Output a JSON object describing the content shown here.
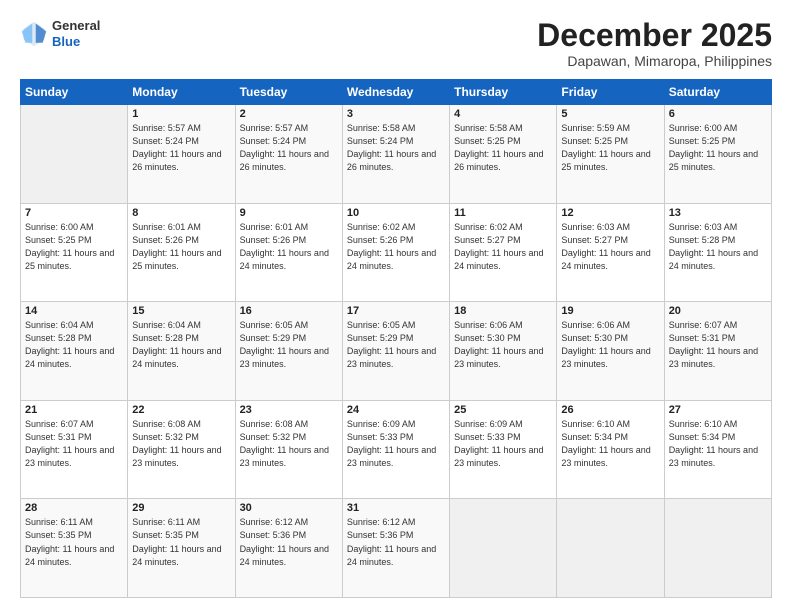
{
  "header": {
    "logo_general": "General",
    "logo_blue": "Blue",
    "title": "December 2025",
    "subtitle": "Dapawan, Mimaropa, Philippines"
  },
  "weekdays": [
    "Sunday",
    "Monday",
    "Tuesday",
    "Wednesday",
    "Thursday",
    "Friday",
    "Saturday"
  ],
  "weeks": [
    [
      {
        "day": "",
        "sunrise": "",
        "sunset": "",
        "daylight": ""
      },
      {
        "day": "1",
        "sunrise": "Sunrise: 5:57 AM",
        "sunset": "Sunset: 5:24 PM",
        "daylight": "Daylight: 11 hours and 26 minutes."
      },
      {
        "day": "2",
        "sunrise": "Sunrise: 5:57 AM",
        "sunset": "Sunset: 5:24 PM",
        "daylight": "Daylight: 11 hours and 26 minutes."
      },
      {
        "day": "3",
        "sunrise": "Sunrise: 5:58 AM",
        "sunset": "Sunset: 5:24 PM",
        "daylight": "Daylight: 11 hours and 26 minutes."
      },
      {
        "day": "4",
        "sunrise": "Sunrise: 5:58 AM",
        "sunset": "Sunset: 5:25 PM",
        "daylight": "Daylight: 11 hours and 26 minutes."
      },
      {
        "day": "5",
        "sunrise": "Sunrise: 5:59 AM",
        "sunset": "Sunset: 5:25 PM",
        "daylight": "Daylight: 11 hours and 25 minutes."
      },
      {
        "day": "6",
        "sunrise": "Sunrise: 6:00 AM",
        "sunset": "Sunset: 5:25 PM",
        "daylight": "Daylight: 11 hours and 25 minutes."
      }
    ],
    [
      {
        "day": "7",
        "sunrise": "Sunrise: 6:00 AM",
        "sunset": "Sunset: 5:25 PM",
        "daylight": "Daylight: 11 hours and 25 minutes."
      },
      {
        "day": "8",
        "sunrise": "Sunrise: 6:01 AM",
        "sunset": "Sunset: 5:26 PM",
        "daylight": "Daylight: 11 hours and 25 minutes."
      },
      {
        "day": "9",
        "sunrise": "Sunrise: 6:01 AM",
        "sunset": "Sunset: 5:26 PM",
        "daylight": "Daylight: 11 hours and 24 minutes."
      },
      {
        "day": "10",
        "sunrise": "Sunrise: 6:02 AM",
        "sunset": "Sunset: 5:26 PM",
        "daylight": "Daylight: 11 hours and 24 minutes."
      },
      {
        "day": "11",
        "sunrise": "Sunrise: 6:02 AM",
        "sunset": "Sunset: 5:27 PM",
        "daylight": "Daylight: 11 hours and 24 minutes."
      },
      {
        "day": "12",
        "sunrise": "Sunrise: 6:03 AM",
        "sunset": "Sunset: 5:27 PM",
        "daylight": "Daylight: 11 hours and 24 minutes."
      },
      {
        "day": "13",
        "sunrise": "Sunrise: 6:03 AM",
        "sunset": "Sunset: 5:28 PM",
        "daylight": "Daylight: 11 hours and 24 minutes."
      }
    ],
    [
      {
        "day": "14",
        "sunrise": "Sunrise: 6:04 AM",
        "sunset": "Sunset: 5:28 PM",
        "daylight": "Daylight: 11 hours and 24 minutes."
      },
      {
        "day": "15",
        "sunrise": "Sunrise: 6:04 AM",
        "sunset": "Sunset: 5:28 PM",
        "daylight": "Daylight: 11 hours and 24 minutes."
      },
      {
        "day": "16",
        "sunrise": "Sunrise: 6:05 AM",
        "sunset": "Sunset: 5:29 PM",
        "daylight": "Daylight: 11 hours and 23 minutes."
      },
      {
        "day": "17",
        "sunrise": "Sunrise: 6:05 AM",
        "sunset": "Sunset: 5:29 PM",
        "daylight": "Daylight: 11 hours and 23 minutes."
      },
      {
        "day": "18",
        "sunrise": "Sunrise: 6:06 AM",
        "sunset": "Sunset: 5:30 PM",
        "daylight": "Daylight: 11 hours and 23 minutes."
      },
      {
        "day": "19",
        "sunrise": "Sunrise: 6:06 AM",
        "sunset": "Sunset: 5:30 PM",
        "daylight": "Daylight: 11 hours and 23 minutes."
      },
      {
        "day": "20",
        "sunrise": "Sunrise: 6:07 AM",
        "sunset": "Sunset: 5:31 PM",
        "daylight": "Daylight: 11 hours and 23 minutes."
      }
    ],
    [
      {
        "day": "21",
        "sunrise": "Sunrise: 6:07 AM",
        "sunset": "Sunset: 5:31 PM",
        "daylight": "Daylight: 11 hours and 23 minutes."
      },
      {
        "day": "22",
        "sunrise": "Sunrise: 6:08 AM",
        "sunset": "Sunset: 5:32 PM",
        "daylight": "Daylight: 11 hours and 23 minutes."
      },
      {
        "day": "23",
        "sunrise": "Sunrise: 6:08 AM",
        "sunset": "Sunset: 5:32 PM",
        "daylight": "Daylight: 11 hours and 23 minutes."
      },
      {
        "day": "24",
        "sunrise": "Sunrise: 6:09 AM",
        "sunset": "Sunset: 5:33 PM",
        "daylight": "Daylight: 11 hours and 23 minutes."
      },
      {
        "day": "25",
        "sunrise": "Sunrise: 6:09 AM",
        "sunset": "Sunset: 5:33 PM",
        "daylight": "Daylight: 11 hours and 23 minutes."
      },
      {
        "day": "26",
        "sunrise": "Sunrise: 6:10 AM",
        "sunset": "Sunset: 5:34 PM",
        "daylight": "Daylight: 11 hours and 23 minutes."
      },
      {
        "day": "27",
        "sunrise": "Sunrise: 6:10 AM",
        "sunset": "Sunset: 5:34 PM",
        "daylight": "Daylight: 11 hours and 23 minutes."
      }
    ],
    [
      {
        "day": "28",
        "sunrise": "Sunrise: 6:11 AM",
        "sunset": "Sunset: 5:35 PM",
        "daylight": "Daylight: 11 hours and 24 minutes."
      },
      {
        "day": "29",
        "sunrise": "Sunrise: 6:11 AM",
        "sunset": "Sunset: 5:35 PM",
        "daylight": "Daylight: 11 hours and 24 minutes."
      },
      {
        "day": "30",
        "sunrise": "Sunrise: 6:12 AM",
        "sunset": "Sunset: 5:36 PM",
        "daylight": "Daylight: 11 hours and 24 minutes."
      },
      {
        "day": "31",
        "sunrise": "Sunrise: 6:12 AM",
        "sunset": "Sunset: 5:36 PM",
        "daylight": "Daylight: 11 hours and 24 minutes."
      },
      {
        "day": "",
        "sunrise": "",
        "sunset": "",
        "daylight": ""
      },
      {
        "day": "",
        "sunrise": "",
        "sunset": "",
        "daylight": ""
      },
      {
        "day": "",
        "sunrise": "",
        "sunset": "",
        "daylight": ""
      }
    ]
  ]
}
